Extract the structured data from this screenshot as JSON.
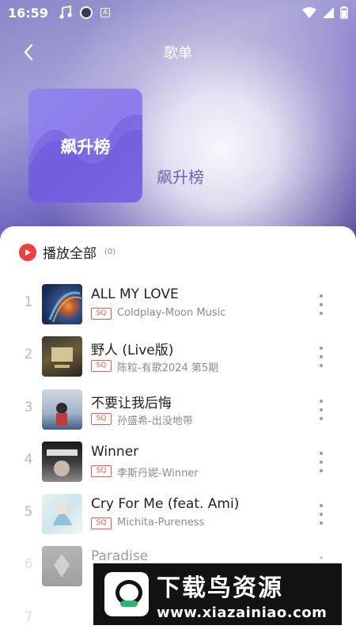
{
  "status_bar": {
    "time": "16:59",
    "notif_a": "A"
  },
  "header": {
    "title": "歌单"
  },
  "playlist": {
    "cover_text": "飙升榜",
    "name": "飙升榜"
  },
  "play_all": {
    "label": "播放全部",
    "count": "(0)"
  },
  "songs": [
    {
      "index": "1",
      "title": "ALL MY LOVE",
      "quality": "SQ",
      "artist": "Coldplay-Moon Music"
    },
    {
      "index": "2",
      "title": "野人 (Live版)",
      "quality": "SQ",
      "artist": "陈粒-有歌2024 第5期"
    },
    {
      "index": "3",
      "title": "不要让我后悔",
      "quality": "SQ",
      "artist": "孙盛希-出没地带"
    },
    {
      "index": "4",
      "title": "Winner",
      "quality": "SQ",
      "artist": "李斯丹妮-Winner"
    },
    {
      "index": "5",
      "title": "Cry For Me (feat. Ami)",
      "quality": "SQ",
      "artist": "Michita-Pureness"
    },
    {
      "index": "6",
      "title": "Paradise",
      "quality": "",
      "artist": ""
    },
    {
      "index": "7",
      "title": "",
      "quality": "",
      "artist": ""
    }
  ],
  "watermark": {
    "title": "下载鸟资源",
    "url": "www.xiazainiao.com"
  },
  "colors": {
    "accent": "#ef3e3e",
    "cover": "#7c66e0",
    "header_bg": "#4b3f9f"
  }
}
